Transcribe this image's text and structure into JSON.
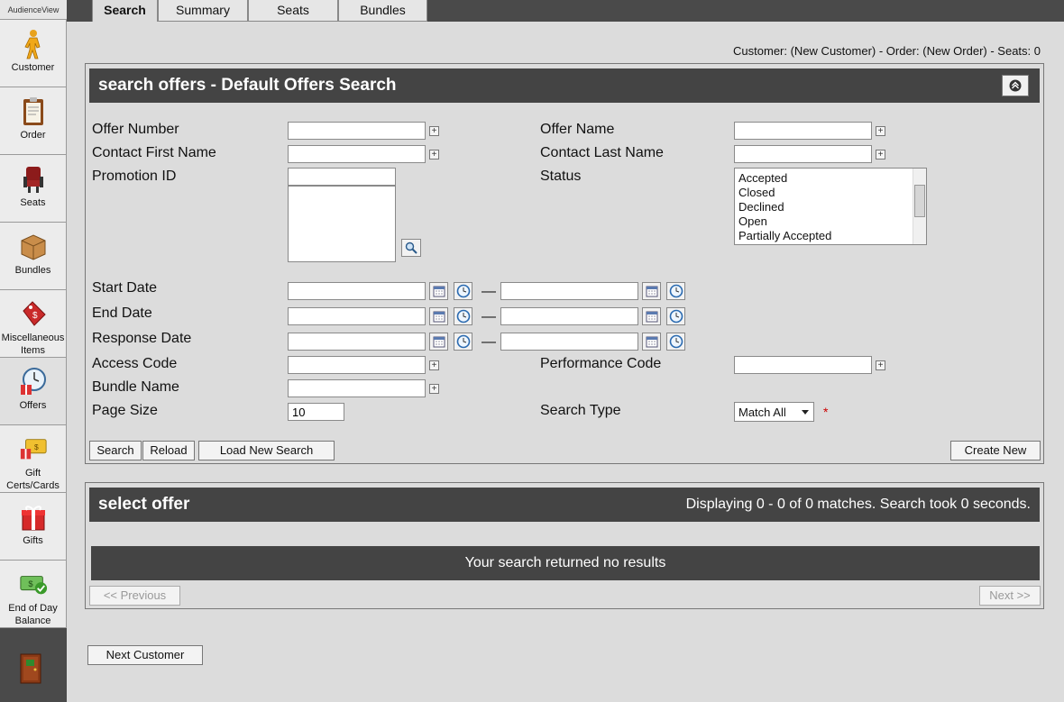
{
  "app": {
    "brand": "AudienceView"
  },
  "sidebar": {
    "items": [
      {
        "label": "Customer"
      },
      {
        "label": "Order"
      },
      {
        "label": "Seats"
      },
      {
        "label": "Bundles"
      },
      {
        "label": "Miscellaneous Items"
      },
      {
        "label": "Offers"
      },
      {
        "label": "Gift Certs/Cards"
      },
      {
        "label": "Gifts"
      },
      {
        "label": "End of Day Balance"
      }
    ]
  },
  "tabs": [
    {
      "label": "Search",
      "active": true
    },
    {
      "label": "Summary"
    },
    {
      "label": "Seats"
    },
    {
      "label": "Bundles"
    }
  ],
  "context_line": "Customer: (New Customer) - Order: (New Order) - Seats: 0",
  "search_panel": {
    "title": "search offers - Default Offers Search",
    "fields": {
      "offer_number": "Offer Number",
      "offer_name": "Offer Name",
      "contact_first_name": "Contact First Name",
      "contact_last_name": "Contact Last Name",
      "promotion_id": "Promotion ID",
      "status": "Status",
      "start_date": "Start Date",
      "end_date": "End Date",
      "response_date": "Response Date",
      "access_code": "Access Code",
      "performance_code": "Performance Code",
      "bundle_name": "Bundle Name",
      "page_size": "Page Size",
      "search_type": "Search Type"
    },
    "page_size_value": "10",
    "status_options": [
      "Accepted",
      "Closed",
      "Declined",
      "Open",
      "Partially Accepted"
    ],
    "search_type_value": "Match All",
    "required_mark": "*",
    "buttons": {
      "search": "Search",
      "reload": "Reload",
      "load_new_search": "Load New Search",
      "create_new": "Create New"
    }
  },
  "results_panel": {
    "title": "select offer",
    "status": "Displaying 0 - 0 of 0 matches. Search took 0 seconds.",
    "empty_message": "Your search returned no results",
    "prev": "<< Previous",
    "next": "Next >>"
  },
  "footer": {
    "next_customer": "Next Customer"
  },
  "colors": {
    "header_bg": "#444444",
    "sidebar_bg": "#4a4a4a",
    "page_bg": "#dcdcdc"
  }
}
